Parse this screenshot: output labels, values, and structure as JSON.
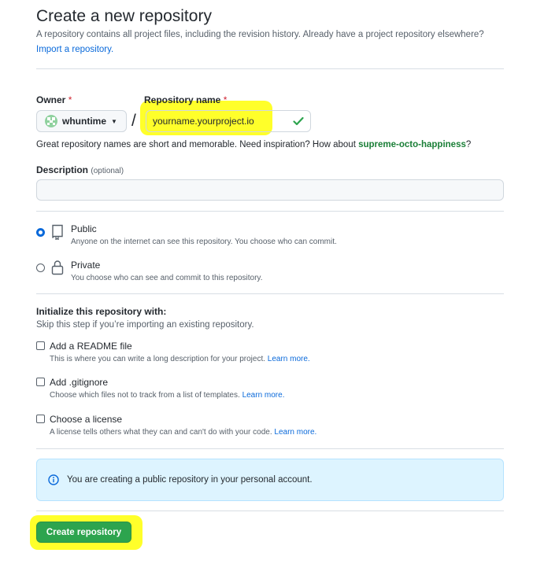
{
  "header": {
    "title": "Create a new repository",
    "description": "A repository contains all project files, including the revision history. Already have a project repository elsewhere?",
    "import_link": "Import a repository."
  },
  "owner": {
    "label": "Owner",
    "required_mark": "*",
    "value": "whuntime"
  },
  "repo_name": {
    "label": "Repository name",
    "required_mark": "*",
    "value": "yourname.yourproject.io",
    "separator": "/"
  },
  "suggestion": {
    "prefix": "Great repository names are short and memorable. Need inspiration? How about",
    "name": "supreme-octo-happiness",
    "suffix": "?"
  },
  "description_field": {
    "label": "Description",
    "optional": "(optional)",
    "value": ""
  },
  "visibility": {
    "selected": "public",
    "options": [
      {
        "key": "public",
        "title": "Public",
        "desc": "Anyone on the internet can see this repository. You choose who can commit."
      },
      {
        "key": "private",
        "title": "Private",
        "desc": "You choose who can see and commit to this repository."
      }
    ]
  },
  "initialize": {
    "title": "Initialize this repository with:",
    "subtitle": "Skip this step if you’re importing an existing repository.",
    "options": [
      {
        "title": "Add a README file",
        "desc": "This is where you can write a long description for your project.",
        "link": "Learn more."
      },
      {
        "title": "Add .gitignore",
        "desc": "Choose which files not to track from a list of templates.",
        "link": "Learn more."
      },
      {
        "title": "Choose a license",
        "desc": "A license tells others what they can and can't do with your code.",
        "link": "Learn more."
      }
    ]
  },
  "info": {
    "text": "You are creating a public repository in your personal account."
  },
  "submit": {
    "label": "Create repository"
  },
  "colors": {
    "accent": "#0969da",
    "success": "#2da44e",
    "highlight": "#ffff2a",
    "suggestion": "#1a7f37"
  }
}
